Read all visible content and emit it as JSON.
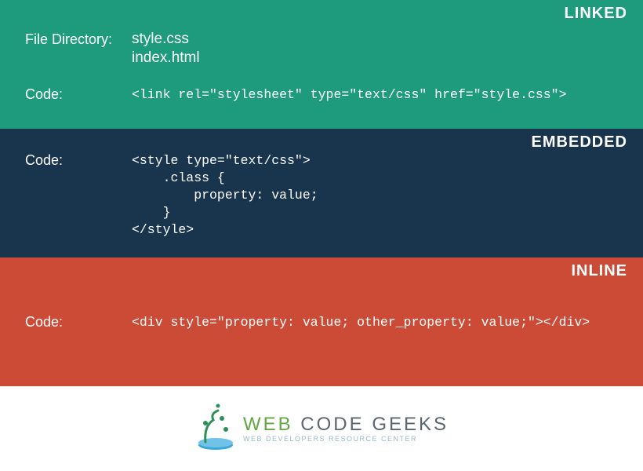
{
  "linked": {
    "badge": "LINKED",
    "dirLabel": "File Directory:",
    "files": "style.css\nindex.html",
    "codeLabel": "Code:",
    "code": "<link rel=\"stylesheet\" type=\"text/css\" href=\"style.css\">"
  },
  "embedded": {
    "badge": "EMBEDDED",
    "codeLabel": "Code:",
    "code": "<style type=\"text/css\">\n    .class {\n        property: value;\n    }\n</style>"
  },
  "inline": {
    "badge": "INLINE",
    "codeLabel": "Code:",
    "code": "<div style=\"property: value; other_property: value;\"></div>"
  },
  "logo": {
    "web": "WEB",
    "rest": " CODE GEEKS",
    "sub": "WEB DEVELOPERS RESOURCE CENTER"
  }
}
